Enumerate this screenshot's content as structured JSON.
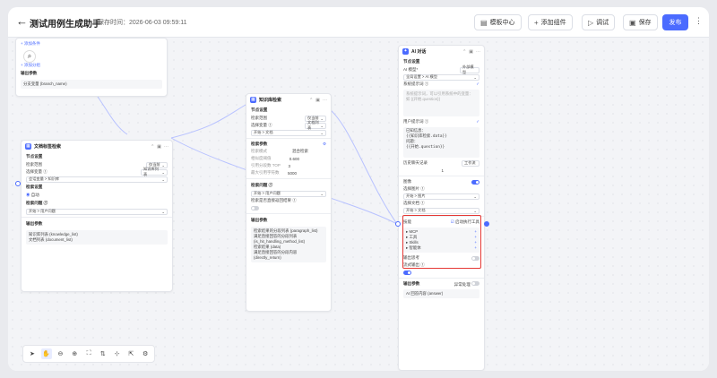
{
  "header": {
    "back_icon": "←",
    "title": "测试用例生成助手",
    "save_time": "保存时间：2026-06-03 09:59:11"
  },
  "toolbar_buttons": {
    "template": "模板中心",
    "add_component": "添加组件",
    "debug": "调试",
    "save": "保存",
    "publish": "发布"
  },
  "node_a": {
    "add_condition": "+ 添加条件",
    "add_group": "+ 添加分组",
    "output_label": "输出参数",
    "output_value": "分支变量 (branch_name)"
  },
  "node_doc": {
    "title": "文档标签检索",
    "sec_node": "节点设置",
    "label_title": "检索范围",
    "label_value": "仅当前",
    "select_var": "选择变量 ①",
    "select_var_value": "知识库列表",
    "select_box": "会话变量 > 知识库",
    "sec_search": "检索设置",
    "radio_label": "自动",
    "sec_question": "检索问题 ①",
    "question_value": "开始 > 用户问题",
    "sec_output": "输出参数",
    "out1": "知识库列表 (knowledge_list)",
    "out2": "文档列表 (document_list)"
  },
  "node_kb": {
    "title": "知识库检索",
    "sec_node": "节点设置",
    "label_range": "检索范围",
    "range_value": "仅当前",
    "select_var": "选择变量 ①",
    "select_var_value": "文档列表",
    "select_box": "开始 > 文档",
    "sec_params": "检索参数",
    "p1": "检索模式",
    "p1v": "混合检索",
    "p2": "相似度阈值",
    "p2v": "0.600",
    "p3": "引用分段数 TOP",
    "p3v": "3",
    "p4": "最大引用字符数",
    "p4v": "5000",
    "sec_question": "检索问题 ①",
    "question_value": "开始 > 用户问题",
    "show_result": "检索是否直接返回结果 ①",
    "sec_output": "输出参数",
    "out1": "检索结果的分段列表 (paragraph_list)",
    "out2": "满足直接回答的分段列表 (is_hit_handling_method_list)",
    "out3": "检索结果 (data)",
    "out4": "满足直接回答的分段内容 (directly_return)"
  },
  "node_ai": {
    "title": "AI 对话",
    "sec_node": "节点设置",
    "model_label": "AI 模型*",
    "model_extra": "外部模型",
    "model_value": "全局设置 > AI 模型",
    "sys_label": "系统提示词 ①",
    "sys_placeholder1": "系统提示词，可以引用系统中的变量：如 {{开始.question}}",
    "user_label": "用户提示词 ①",
    "user_line1": "已知信息：",
    "user_line2": "{{知识库检索.data}}",
    "user_line3": "问题：",
    "user_line4": "{{开始.question}}",
    "history_label": "历史聊天记录",
    "history_value": "工作流",
    "history_count": "1",
    "image_label": "图像",
    "image_select_label": "选择图片 ①",
    "image_select_value": "开始 > 图片",
    "doc_select_label": "选择文档 ①",
    "doc_select_value": "开始 > 文档",
    "tools_label": "技能",
    "tools_extra": "启动执行工具",
    "tool1": "MCP",
    "tool2": "工具",
    "tool3": "Skills",
    "tool4": "智能体",
    "reasoning_label": "输出思考",
    "stream_label": "流式输出 ①",
    "sec_output": "输出参数",
    "out1": "AI 回答内容 (answer)",
    "output_switch": "异常处理"
  }
}
